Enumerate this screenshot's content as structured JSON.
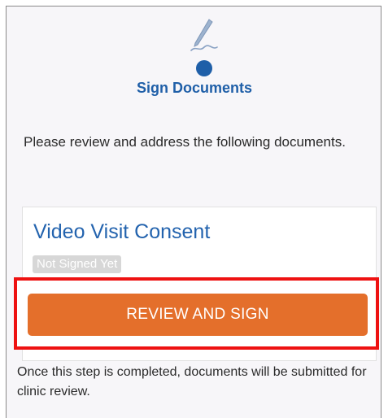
{
  "header": {
    "icon": "signature-pen-icon",
    "title": "Sign Documents"
  },
  "instruction": "Please review and address the following documents.",
  "document": {
    "title": "Video Visit Consent",
    "status": "Not Signed Yet"
  },
  "actions": {
    "review_sign_label": "REVIEW AND SIGN"
  },
  "footer_note": "Once this step is completed, documents will be submitted for clinic review.",
  "colors": {
    "brand_blue": "#1f5fa8",
    "button_orange": "#e46f2b",
    "highlight_red": "#ee1111",
    "status_gray": "#d7d7d7"
  }
}
